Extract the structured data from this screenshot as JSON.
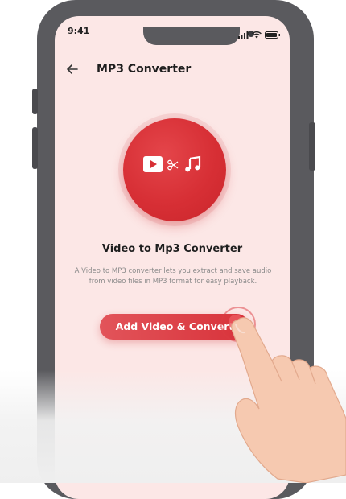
{
  "status_bar": {
    "time": "9:41"
  },
  "header": {
    "title": "MP3 Converter"
  },
  "hero": {
    "icons": [
      "video-play-icon",
      "scissors-icon",
      "music-note-icon"
    ]
  },
  "content": {
    "heading": "Video to Mp3 Converter",
    "description": "A Video to MP3 converter lets you extract and save audio from video files in MP3 format for easy playback."
  },
  "cta": {
    "label": "Add Video & Convert"
  },
  "colors": {
    "accent": "#d8323a",
    "screen_background": "#fce7e6",
    "phone_frame": "#5a5a5e",
    "skin": "#f6c9b0"
  }
}
